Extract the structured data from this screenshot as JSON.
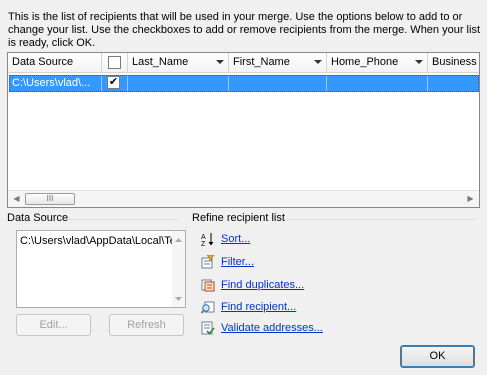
{
  "intro_text": "This is the list of recipients that will be used in your merge.  Use the options below to add to or change your list.  Use the checkboxes to add or remove recipients from the merge.  When your list is ready, click OK.",
  "grid": {
    "columns": [
      "Data Source",
      "",
      "Last_Name",
      "First_Name",
      "Home_Phone",
      "Business"
    ],
    "rows": [
      {
        "data_source": "C:\\Users\\vlad\\...",
        "checked": "✔",
        "last_name": "",
        "first_name": "",
        "home_phone": "",
        "business": ""
      }
    ],
    "scroll_thumb_label": "III"
  },
  "data_source_group": {
    "title": "Data Source",
    "items": [
      "C:\\Users\\vlad\\AppData\\Local\\Te"
    ],
    "edit_label": "Edit...",
    "refresh_label": "Refresh"
  },
  "refine_group": {
    "title": "Refine recipient list",
    "links": [
      "Sort...",
      "Filter...",
      "Find duplicates...",
      "Find recipient...",
      "Validate addresses..."
    ]
  },
  "ok_label": "OK",
  "colors": {
    "selection": "#3399ff",
    "link": "#0033cc"
  }
}
